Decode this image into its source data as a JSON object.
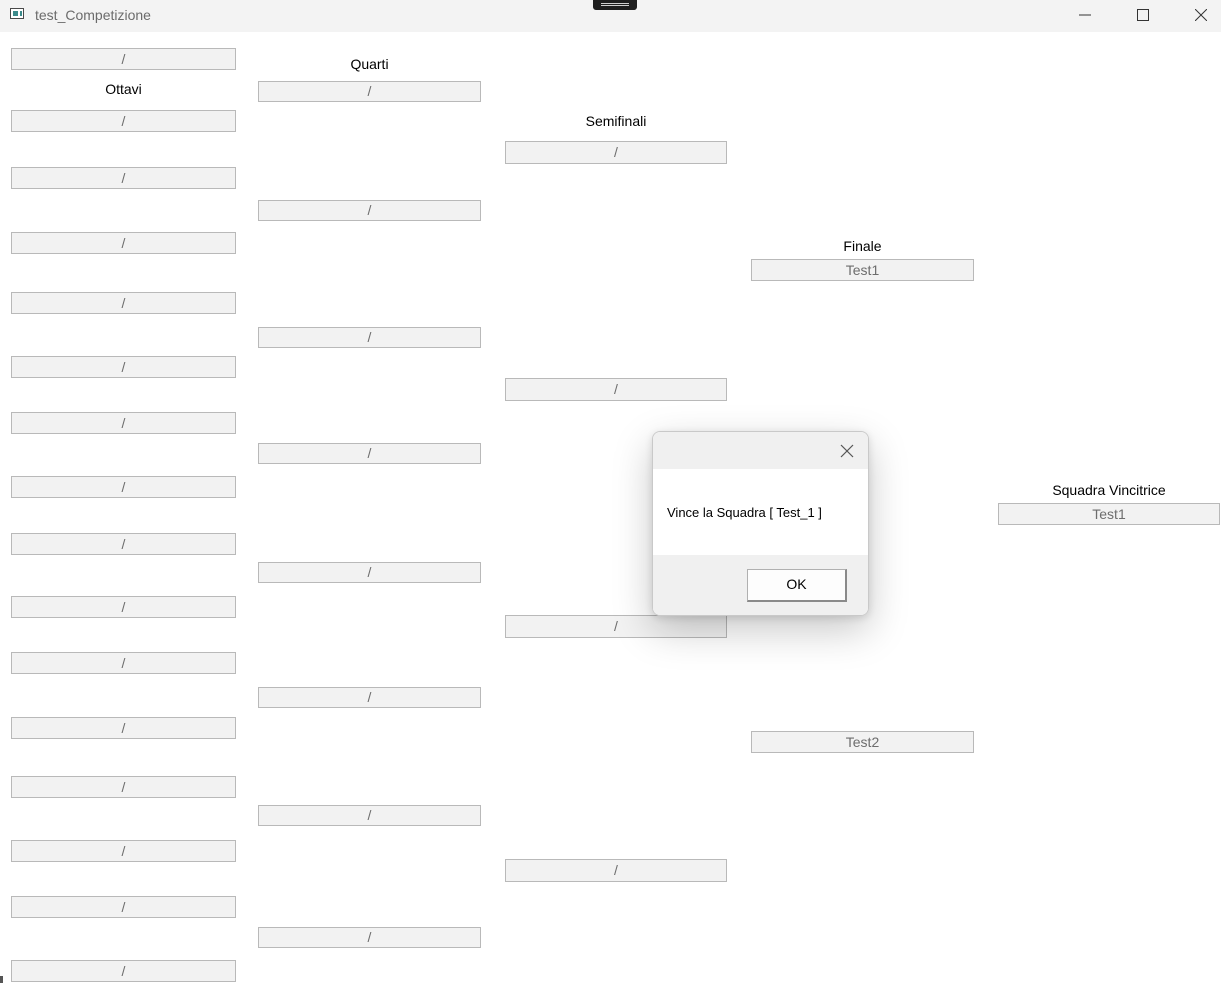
{
  "window": {
    "title": "test_Competizione"
  },
  "columns": {
    "ottavi": {
      "label": "Ottavi",
      "slots": [
        "/",
        "/",
        "/",
        "/",
        "/",
        "/",
        "/",
        "/",
        "/",
        "/",
        "/",
        "/",
        "/",
        "/",
        "/",
        "/",
        "/"
      ]
    },
    "quarti": {
      "label": "Quarti",
      "slots": [
        "/",
        "/",
        "/",
        "/",
        "/",
        "/",
        "/",
        "/",
        "/"
      ]
    },
    "semifinali": {
      "label": "Semifinali",
      "slots": [
        "/",
        "/",
        "/",
        "/"
      ]
    },
    "finale": {
      "label": "Finale",
      "slots": [
        "Test1",
        "Test2"
      ]
    },
    "vincitrice": {
      "label": "Squadra Vincitrice",
      "slots": [
        "Test1"
      ]
    }
  },
  "dialog": {
    "message": "Vince la Squadra [ Test_1 ]",
    "ok_label": "OK"
  },
  "icons": {
    "app": "app-window-icon",
    "minimize": "minimize-icon",
    "maximize": "maximize-icon",
    "close": "close-icon",
    "dialog_close": "close-icon"
  }
}
